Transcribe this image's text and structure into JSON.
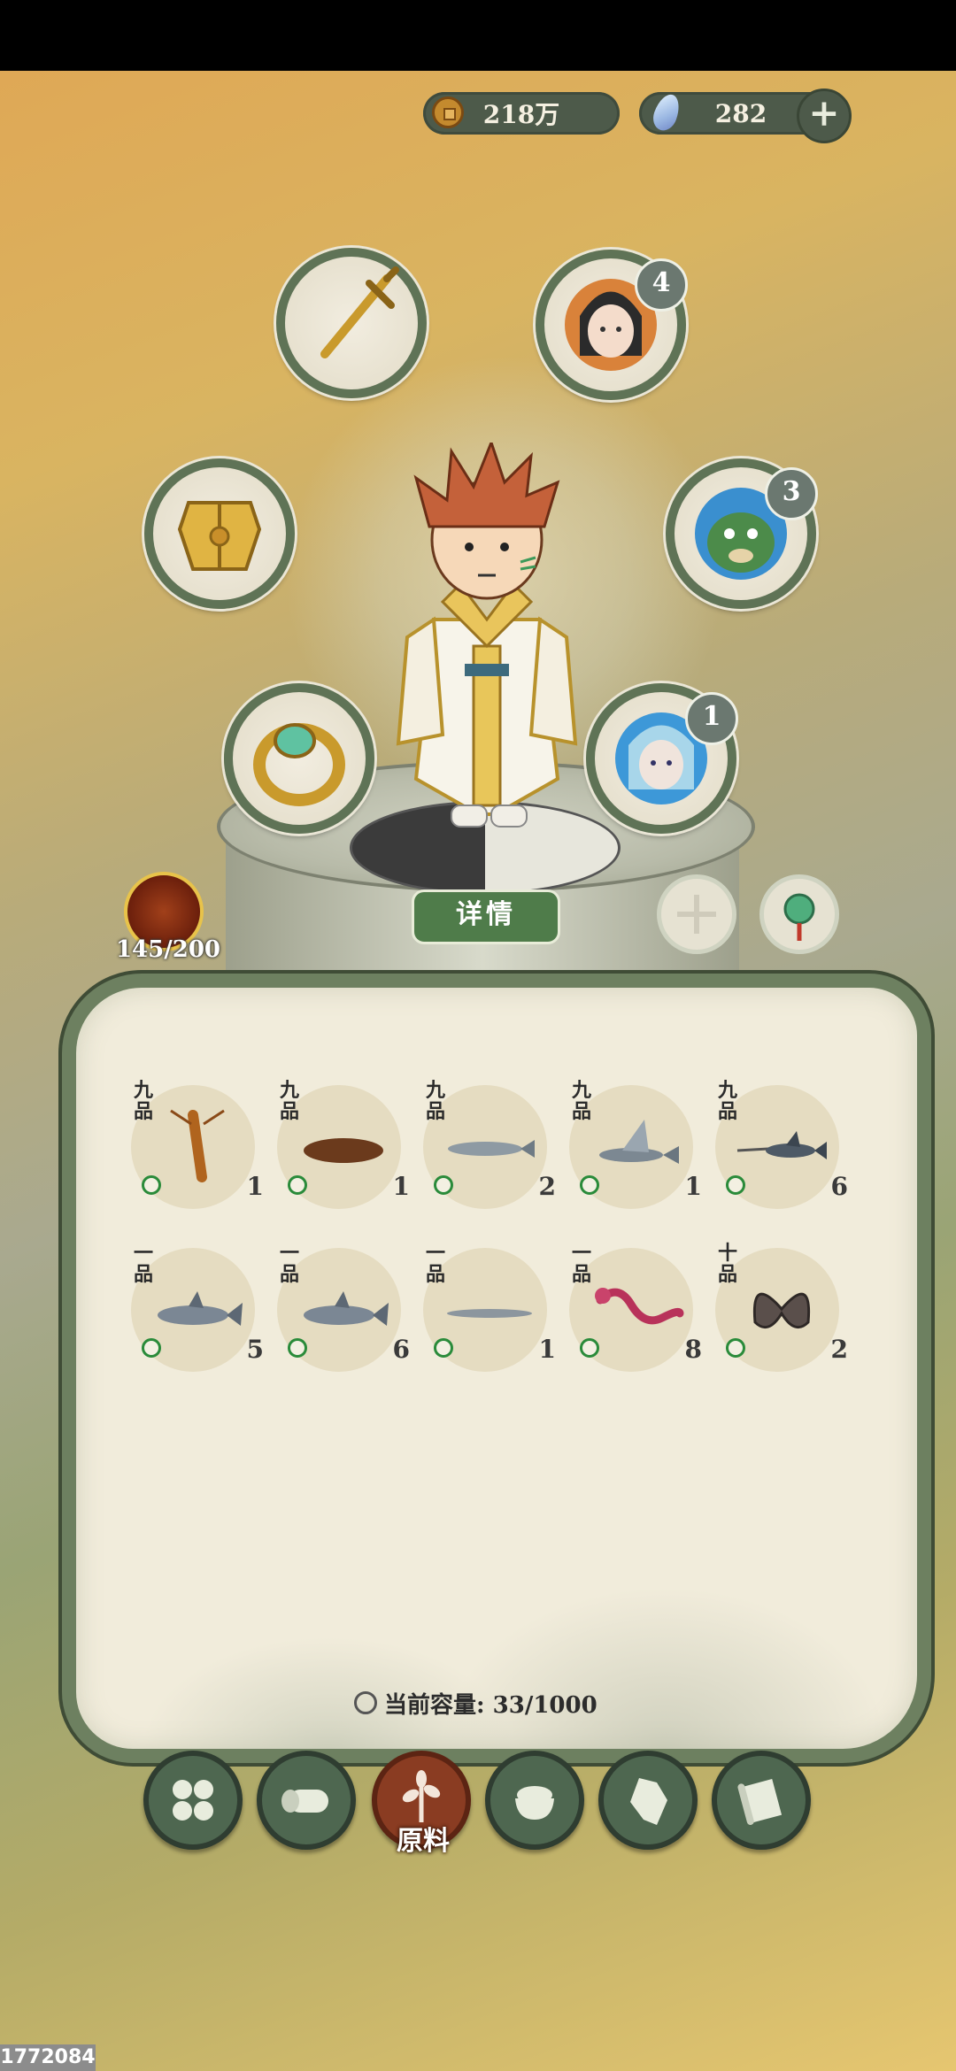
{
  "currency": {
    "coins": "218万",
    "gems": "282",
    "add_label": "+"
  },
  "equipment": {
    "weapon_icon": "sword-icon",
    "armor_icon": "armor-icon",
    "ring_icon": "ring-icon",
    "companions": [
      {
        "icon": "companion-lady-portrait",
        "count": "4"
      },
      {
        "icon": "companion-fish-spirit-portrait",
        "count": "3"
      },
      {
        "icon": "companion-blue-spirit-portrait",
        "count": "1"
      }
    ]
  },
  "details_button": "详情",
  "stamina": "145/200",
  "inventory": {
    "items": [
      {
        "grade": "九品",
        "name": "lobster",
        "count": "1"
      },
      {
        "grade": "九品",
        "name": "sea-cucumber",
        "count": "1"
      },
      {
        "grade": "九品",
        "name": "fish",
        "count": "2"
      },
      {
        "grade": "九品",
        "name": "flying-fish",
        "count": "1"
      },
      {
        "grade": "九品",
        "name": "swordfish",
        "count": "6"
      },
      {
        "grade": "一品",
        "name": "shark",
        "count": "5"
      },
      {
        "grade": "一品",
        "name": "shark",
        "count": "6"
      },
      {
        "grade": "一品",
        "name": "needlefish",
        "count": "1"
      },
      {
        "grade": "一品",
        "name": "dragon",
        "count": "8"
      },
      {
        "grade": "十品",
        "name": "butterfly",
        "count": "2"
      }
    ],
    "capacity": "当前容量: 33/1000"
  },
  "nav": {
    "active_label": "原料",
    "buttons": [
      "all-icon",
      "wood-icon",
      "herb-icon",
      "rice-bowl-icon",
      "ore-icon",
      "scroll-icon"
    ]
  },
  "watermark": "1772084"
}
